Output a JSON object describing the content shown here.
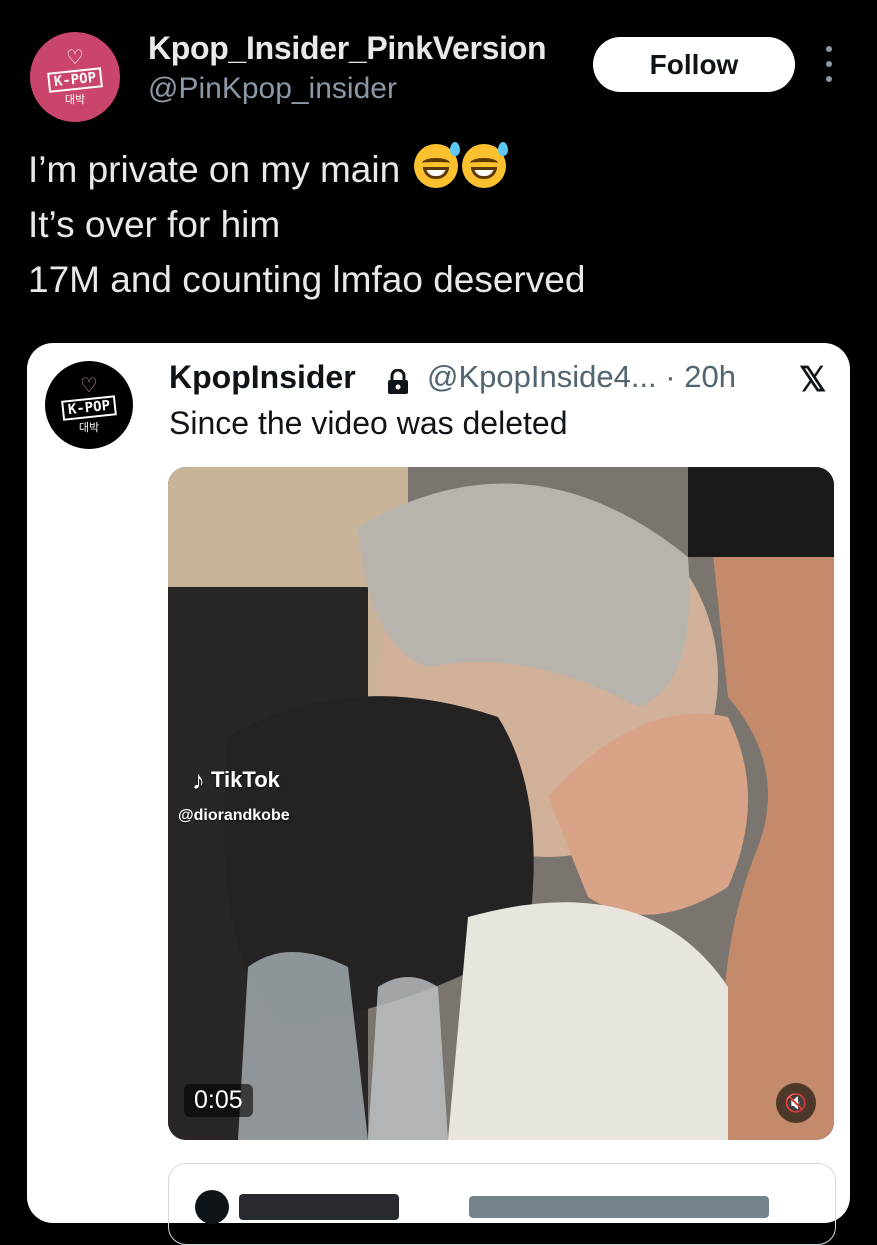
{
  "post": {
    "author_name": "Kpop_Insider_PinkVersion",
    "author_handle": "@PinKpop_insider",
    "follow_label": "Follow",
    "more_icon": "more-vertical-icon",
    "avatar": {
      "badge": "K-POP",
      "korean": "대박",
      "icon": "heart-icon",
      "bg_color": "#c9456b"
    },
    "lines": [
      "I’m private on my main",
      "It’s over for him",
      "17M and counting lmfao deserved"
    ],
    "line1_emojis": [
      "grinning-sweat-emoji",
      "grinning-sweat-emoji"
    ]
  },
  "quote": {
    "author_name": "KpopInsider",
    "lock_icon": "lock-icon",
    "author_handle_time": "@KpopInside4... · 20h",
    "logo_icon": "x-logo-icon",
    "text": "Since the video was deleted",
    "avatar": {
      "badge": "K-POP",
      "korean": "대박",
      "icon": "heart-icon",
      "bg_color": "#000000"
    },
    "media": {
      "watermark_brand": "TikTok",
      "watermark_user": "@diorandkobe",
      "duration": "0:05",
      "mute_icon": "speaker-muted-icon"
    }
  },
  "colors": {
    "background": "#000000",
    "text_primary": "#e7e9ea",
    "text_secondary": "#8b98a5",
    "card_bg": "#ffffff"
  }
}
